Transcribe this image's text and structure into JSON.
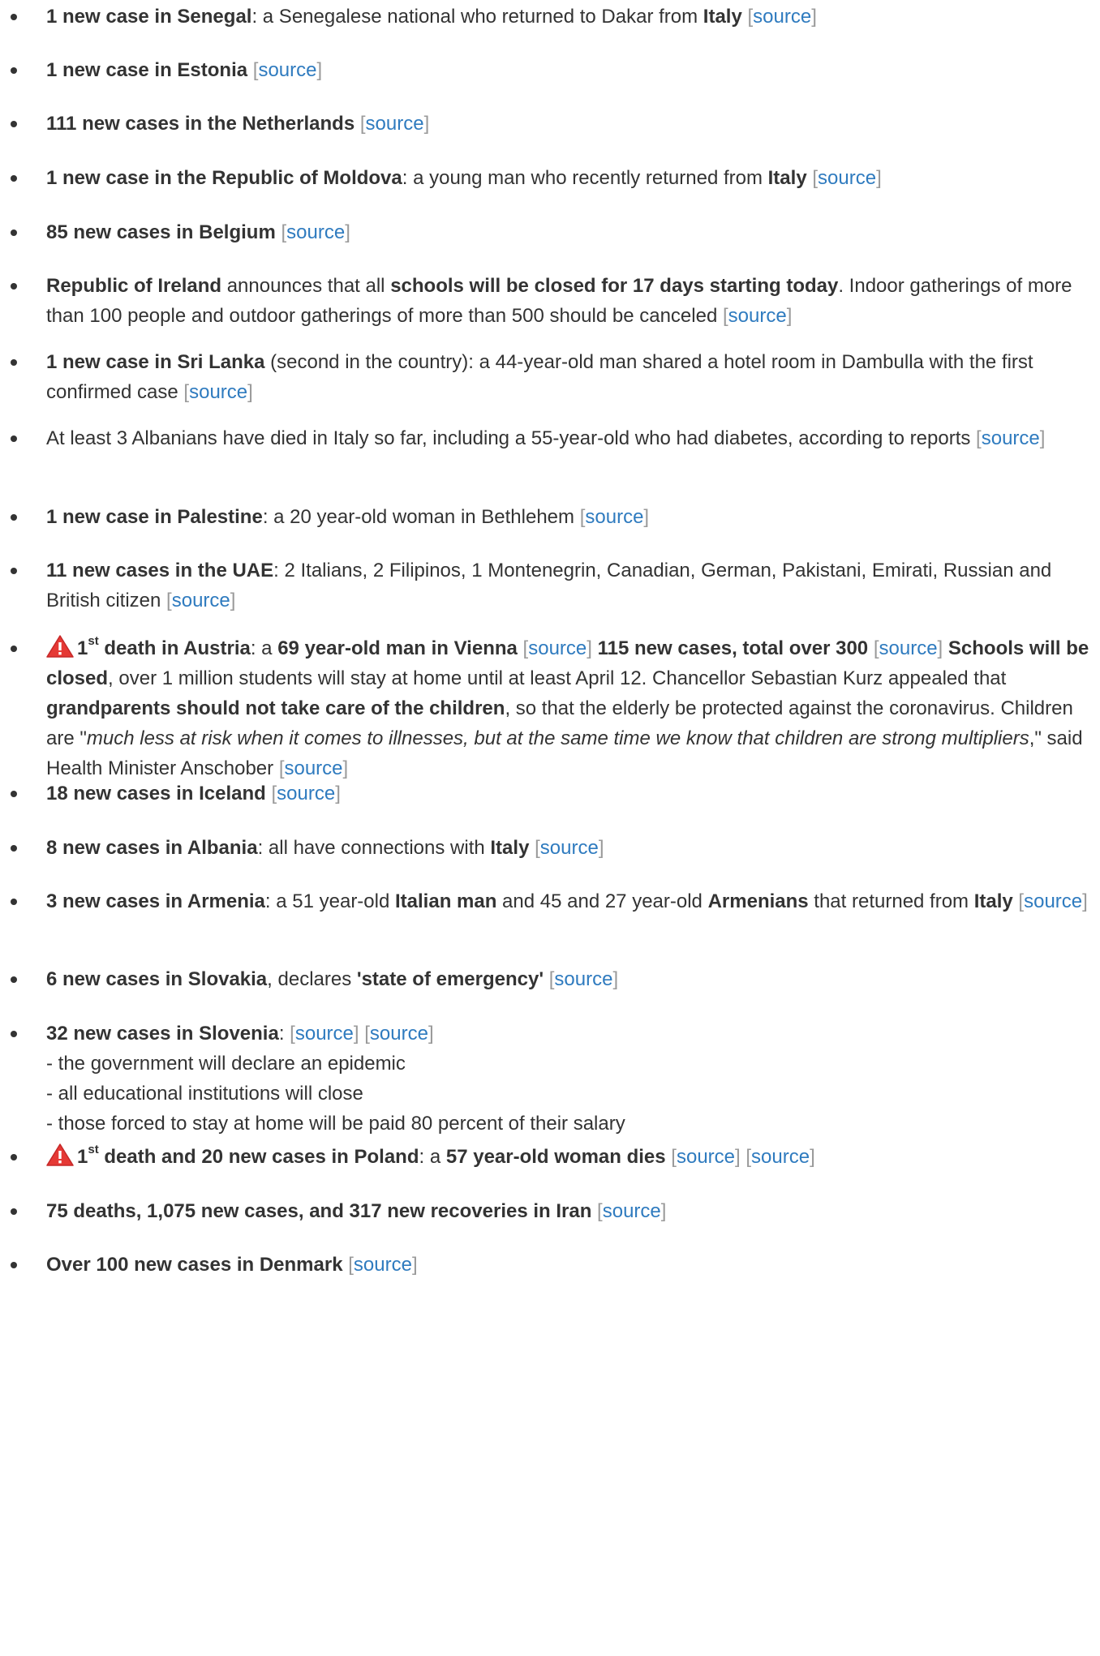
{
  "source_label": "source",
  "items": [
    {
      "b1": "1 new case in Senegal",
      "t1": ": a Senegalese national who returned to Dakar from ",
      "b2": "Italy"
    },
    {
      "b1": "1 new case in Estonia"
    },
    {
      "b1": "111 new cases in the Netherlands"
    },
    {
      "b1": "1 new case in the Republic of Moldova",
      "t1": ": a young man who recently returned from ",
      "b2": "Italy"
    },
    {
      "b1": "85 new cases in Belgium"
    },
    {
      "b1": "Republic of Ireland",
      "t1": " announces that all ",
      "b2": "schools will be closed for 17 days starting today",
      "t2": ". Indoor gatherings of more than 100 people and outdoor gatherings of more than 500 should be canceled"
    },
    {
      "b1": "1 new case in Sri Lanka",
      "t1": " (second in the country): a 44-year-old man shared a hotel room in Dambulla with the first confirmed case"
    },
    {
      "t1": "At least 3 Albanians have died in Italy so far, including a 55-year-old who had diabetes, according to reports"
    },
    {
      "b1": "1 new case in Palestine",
      "t1": ": a 20 year-old woman in Bethlehem"
    },
    {
      "b1": "11 new cases in the UAE",
      "t1": ": 2 Italians, 2 Filipinos, 1 Montenegrin, Canadian, German, Pakistani, Emirati, Russian and British citizen"
    },
    {
      "ord_num": "1",
      "ord_sup": "st",
      "b1": " death in Austria",
      "t1": ": a ",
      "b2": "69 year-old man in Vienna",
      "b3": "115 new cases, total over 300",
      "b4": "Schools will be closed",
      "t2": ", over 1 million students will stay at home until at least April 12. Chancellor Sebastian Kurz appealed that ",
      "b5": "grandparents should not take care of the children",
      "t3": ", so that the elderly be protected against the coronavirus. Children are \"",
      "i1": "much less at risk when it comes to illnesses, but at the same time we know that children are strong multipliers",
      "t4": ",\" said Health Minister Anschober"
    },
    {
      "b1": "18 new cases in Iceland"
    },
    {
      "b1": "8 new cases in Albania",
      "t1": ": all have connections with ",
      "b2": "Italy"
    },
    {
      "b1": "3 new cases in Armenia",
      "t1": ": a 51 year-old ",
      "b2": "Italian man",
      "t2": " and 45 and 27 year-old ",
      "b3": "Armenians",
      "t3": " that returned from ",
      "b4": "Italy"
    },
    {
      "b1": "6 new cases in Slovakia",
      "t1": ", declares ",
      "b2": "'state of emergency'"
    },
    {
      "b1": "32 new cases in Slovenia",
      "t1": ": ",
      "lines": [
        "- the government will declare an epidemic",
        "- all educational institutions will close",
        "- those forced to stay at home will be paid 80 percent of their salary"
      ]
    },
    {
      "ord_num": "1",
      "ord_sup": "st",
      "b1": " death and 20 new cases in Poland",
      "t1": ": a ",
      "b2": "57 year-old woman dies"
    },
    {
      "b1": "75 deaths, 1,075 new cases, and 317 new recoveries in Iran"
    },
    {
      "b1": "Over 100 new cases in Denmark"
    }
  ]
}
